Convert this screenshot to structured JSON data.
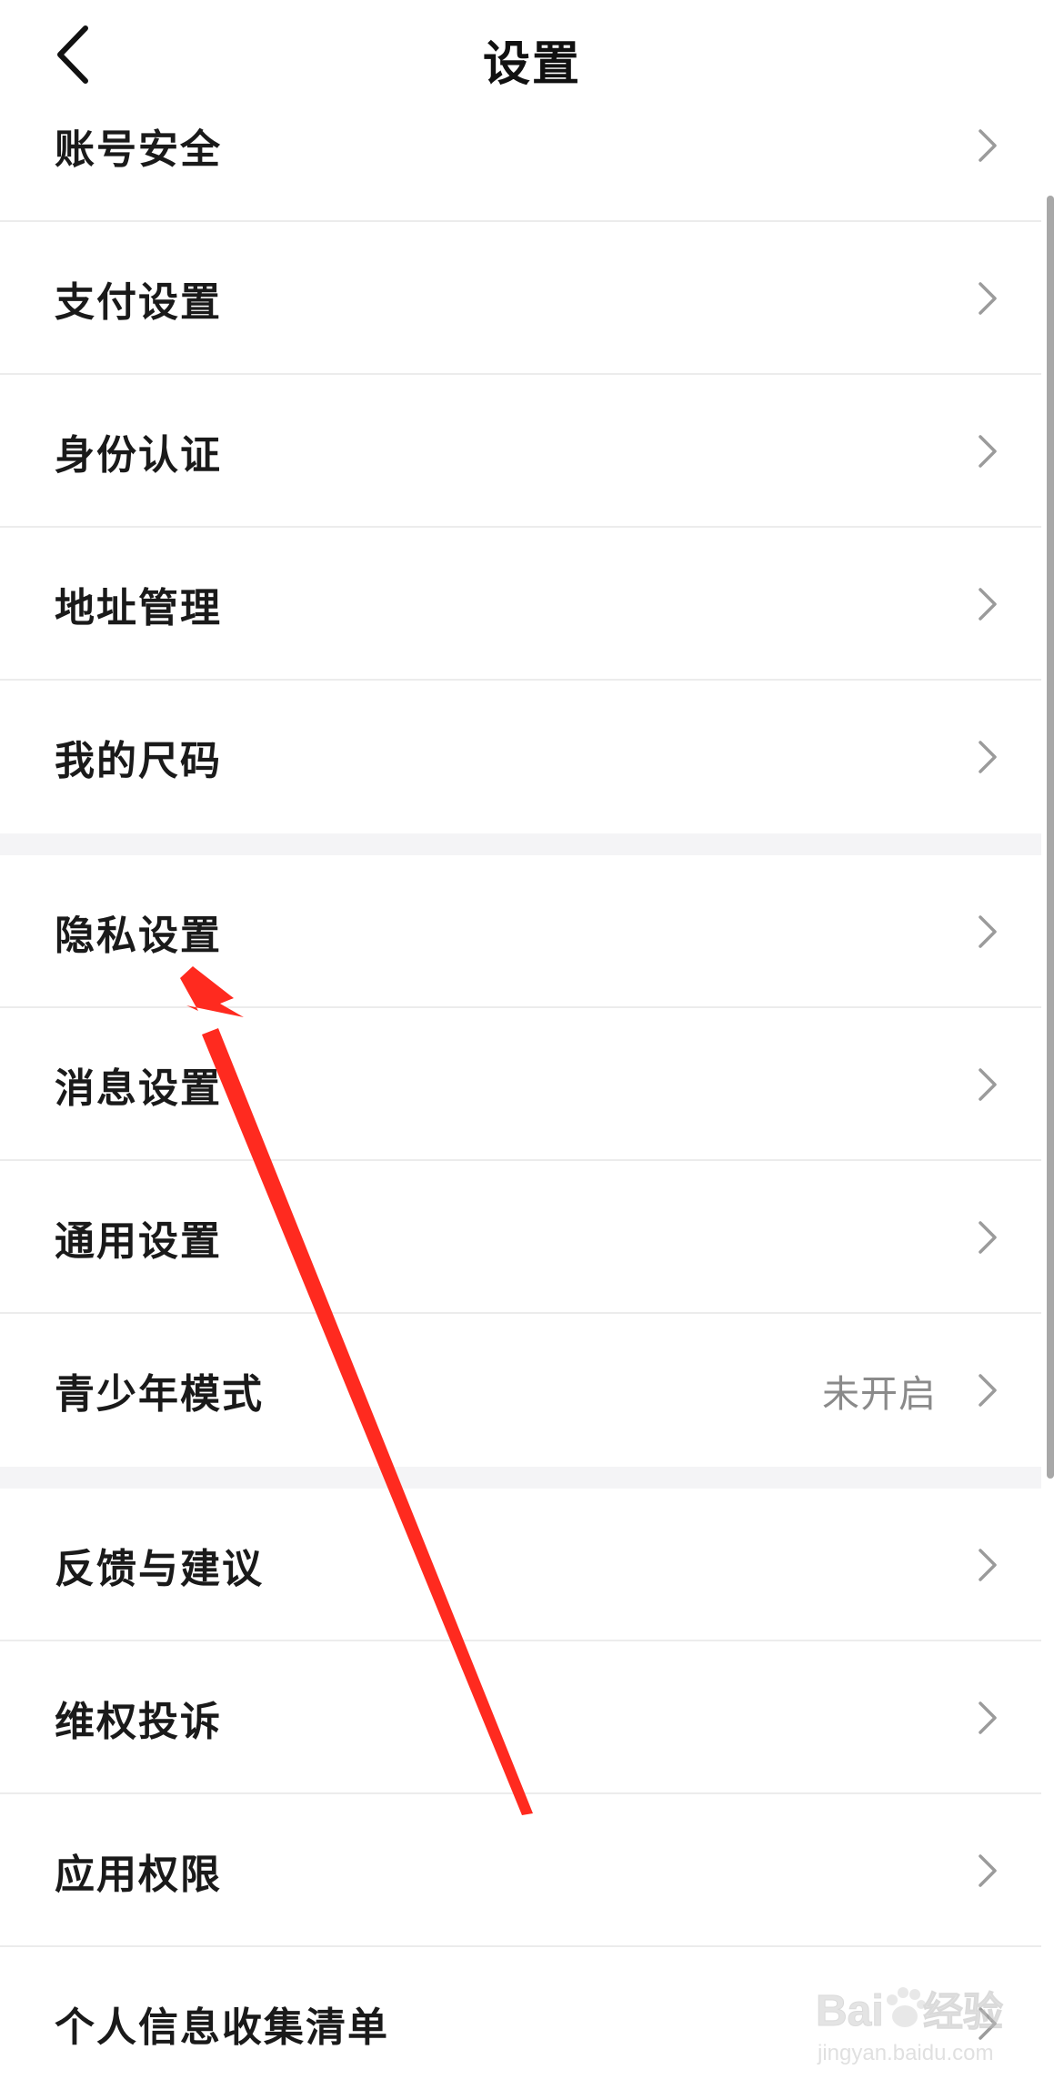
{
  "header": {
    "title": "设置",
    "back_icon": "chevron-left-icon"
  },
  "settings": {
    "group1": [
      {
        "label": "账号安全"
      },
      {
        "label": "支付设置"
      },
      {
        "label": "身份认证"
      },
      {
        "label": "地址管理"
      },
      {
        "label": "我的尺码"
      }
    ],
    "group2": [
      {
        "label": "隐私设置"
      },
      {
        "label": "消息设置"
      },
      {
        "label": "通用设置"
      },
      {
        "label": "青少年模式",
        "value": "未开启"
      }
    ],
    "group3": [
      {
        "label": "反馈与建议"
      },
      {
        "label": "维权投诉"
      },
      {
        "label": "应用权限"
      },
      {
        "label": "个人信息收集清单"
      }
    ]
  },
  "annotation": {
    "type": "red-arrow",
    "color": "#ff2a1f",
    "points_to": "隐私设置"
  },
  "watermark": {
    "logo_text": "Baidu经验",
    "url_text": "jingyan.baidu.com"
  }
}
